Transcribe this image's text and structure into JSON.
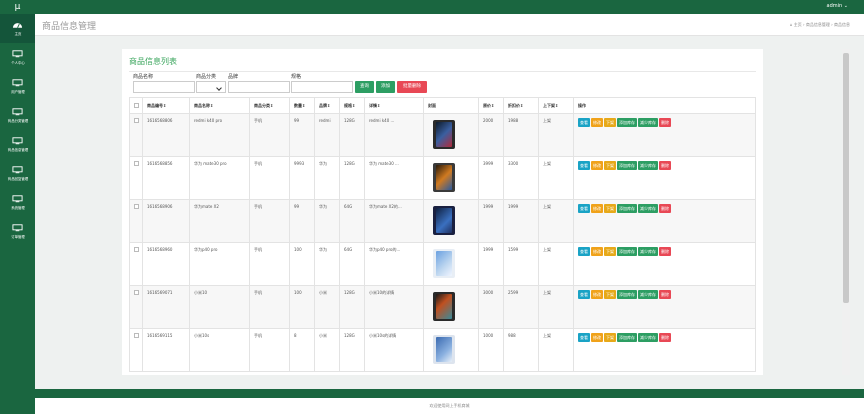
{
  "app": {
    "logo": "μ",
    "user_menu": "admin ⌄"
  },
  "sidebar": {
    "items": [
      {
        "label": "主页",
        "icon": "dashboard-icon"
      },
      {
        "label": "个人中心",
        "icon": "monitor-icon"
      },
      {
        "label": "用户管理",
        "icon": "monitor-icon"
      },
      {
        "label": "商品分类管理",
        "icon": "monitor-icon"
      },
      {
        "label": "商品信息管理",
        "icon": "monitor-icon"
      },
      {
        "label": "商品回复管理",
        "icon": "monitor-icon"
      },
      {
        "label": "系统管理",
        "icon": "monitor-icon"
      },
      {
        "label": "订单管理",
        "icon": "monitor-icon"
      }
    ]
  },
  "header": {
    "title": "商品信息管理",
    "breadcrumb": "⌂ 主页 › 商品信息管理 › 商品信息"
  },
  "card": {
    "title": "商品信息列表",
    "filters": {
      "name_label": "商品名称",
      "category_label": "商品分类",
      "brand_label": "品牌",
      "spec_label": "规格"
    },
    "buttons": {
      "search": "查询",
      "add": "添加",
      "batch_delete": "批量删除"
    }
  },
  "table": {
    "headers": [
      "商品编号⇕",
      "商品名称⇕",
      "商品分类⇕",
      "数量⇕",
      "品牌⇕",
      "规格⇕",
      "详情⇕",
      "封面",
      "原价⇕",
      "折扣价⇕",
      "上下架⇕",
      "操作"
    ],
    "rows": [
      {
        "id": "1616568806",
        "name": "redmi k40 pro",
        "cat": "手机",
        "qty": "99",
        "brand": "redmi",
        "spec": "128G",
        "detail": "redmi k40 ...",
        "price": "2000",
        "discount": "1988",
        "status": "上架"
      },
      {
        "id": "1616568856",
        "name": "华为 mate30 pro",
        "cat": "手机",
        "qty": "9993",
        "brand": "华为",
        "spec": "128G",
        "detail": "华为 mate30 ...",
        "price": "3999",
        "discount": "3300",
        "status": "上架"
      },
      {
        "id": "1616568906",
        "name": "华为mate X2",
        "cat": "手机",
        "qty": "99",
        "brand": "华为",
        "spec": "64G",
        "detail": "华为mate X2的...",
        "price": "1999",
        "discount": "1999",
        "status": "上架"
      },
      {
        "id": "1616568960",
        "name": "华为p40 pro",
        "cat": "手机",
        "qty": "100",
        "brand": "华为",
        "spec": "64G",
        "detail": "华为p40 pro的...",
        "price": "1999",
        "discount": "1599",
        "status": "上架"
      },
      {
        "id": "1616569071",
        "name": "小米10",
        "cat": "手机",
        "qty": "100",
        "brand": "小米",
        "spec": "128G",
        "detail": "小米10的详情",
        "price": "3000",
        "discount": "2599",
        "status": "上架"
      },
      {
        "id": "1616569115",
        "name": "小米10s",
        "cat": "手机",
        "qty": "8",
        "brand": "小米",
        "spec": "128G",
        "detail": "小米10s的详情",
        "price": "1000",
        "discount": "988",
        "status": "上架"
      }
    ],
    "ops": [
      "查看",
      "修改",
      "下架",
      "添加库存",
      "减少库存",
      "删除"
    ]
  },
  "footer": {
    "text": "欢迎使用网上手机商城"
  },
  "colors": {
    "sidebar": "#1a6640",
    "title_green": "#3aa55c",
    "view": "#1aa3c5",
    "edit": "#f0a21a",
    "offshelf": "#e7a919",
    "add_stock": "#2d9e63",
    "reduce_stock": "#2d9e63",
    "delete": "#e84855"
  }
}
